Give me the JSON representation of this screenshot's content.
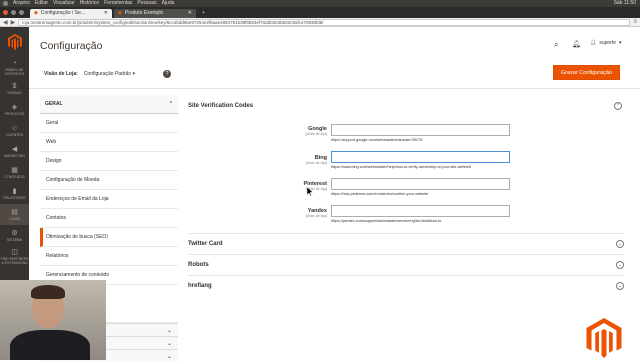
{
  "os_menu": {
    "items": [
      "Arquivo",
      "Editar",
      "Visualizar",
      "Histórico",
      "Ferramentas",
      "Pessoas",
      "Ajuda"
    ],
    "clock": "Sáb 11:50"
  },
  "browser": {
    "tabs": [
      {
        "label": "Configuração / Se...",
        "active": true
      },
      {
        "label": "Produto Exemplo",
        "active": false
      }
    ],
    "url": "loja.mestremagento.com.br/js/admin/system_config/edit/section/seo/key/6cc4bdd6be97294e2f5aae4884781b39f9b53ef70dd0304b833c9afc470938fd8/"
  },
  "sidebar": {
    "items": [
      {
        "label": "PAINEL DE CONTROLE",
        "icon": "dashboard-icon",
        "glyph": "◔"
      },
      {
        "label": "VENDAS",
        "icon": "dollar-icon",
        "glyph": "$"
      },
      {
        "label": "PRODUTOS",
        "icon": "box-icon",
        "glyph": "◈"
      },
      {
        "label": "CLIENTES",
        "icon": "person-icon",
        "glyph": "☺"
      },
      {
        "label": "MARKETING",
        "icon": "megaphone-icon",
        "glyph": "◀"
      },
      {
        "label": "CONTEÚDO",
        "icon": "layout-icon",
        "glyph": "▦"
      },
      {
        "label": "RELATÓRIOS",
        "icon": "bar-chart-icon",
        "glyph": "▮"
      },
      {
        "label": "LOJAS",
        "icon": "store-icon",
        "glyph": "▤"
      },
      {
        "label": "SISTEMA",
        "icon": "gear-icon",
        "glyph": "⚙"
      },
      {
        "label": "FIND PARTNERS & EXTENSIONS",
        "icon": "puzzle-icon",
        "glyph": "◫"
      }
    ]
  },
  "header": {
    "title": "Configuração",
    "user": "suporte"
  },
  "store_view": {
    "label": "Visão de Loja:",
    "value": "Configuração Padrão"
  },
  "save_label": "Gravar Configuração",
  "config_tabs": {
    "section_title": "GERAL",
    "items": [
      "Geral",
      "Web",
      "Design",
      "Configuração de Moeda",
      "Endereços de Email da Loja",
      "Contatos",
      "Otimização de busca (SEO)",
      "Relatórios",
      "Gerenciamento de conteúdo"
    ],
    "active_index": 6
  },
  "seo": {
    "title": "Site Verification Codes",
    "scope": "[visão de loja]",
    "fields": [
      {
        "label": "Google",
        "value": "",
        "note": "https://support.google.com/webmasters/answer/35179"
      },
      {
        "label": "Bing",
        "value": "",
        "note": "https://www.bing.com/webmaster/help/how-to-verify-ownership-of-your-site-afcfefc6"
      },
      {
        "label": "Pinterest",
        "value": "",
        "note": "https://help.pinterest.com/en/articles/confirm-your-website"
      },
      {
        "label": "Yandex",
        "value": "",
        "note": "https://yandex.com/support/webmaster/service/rights.html#how-to"
      }
    ]
  },
  "sections": [
    "Twitter Card",
    "Robots",
    "hreflang"
  ],
  "colors": {
    "accent": "#eb5202",
    "sidebar": "#373330",
    "focus": "#4a8fd9"
  }
}
